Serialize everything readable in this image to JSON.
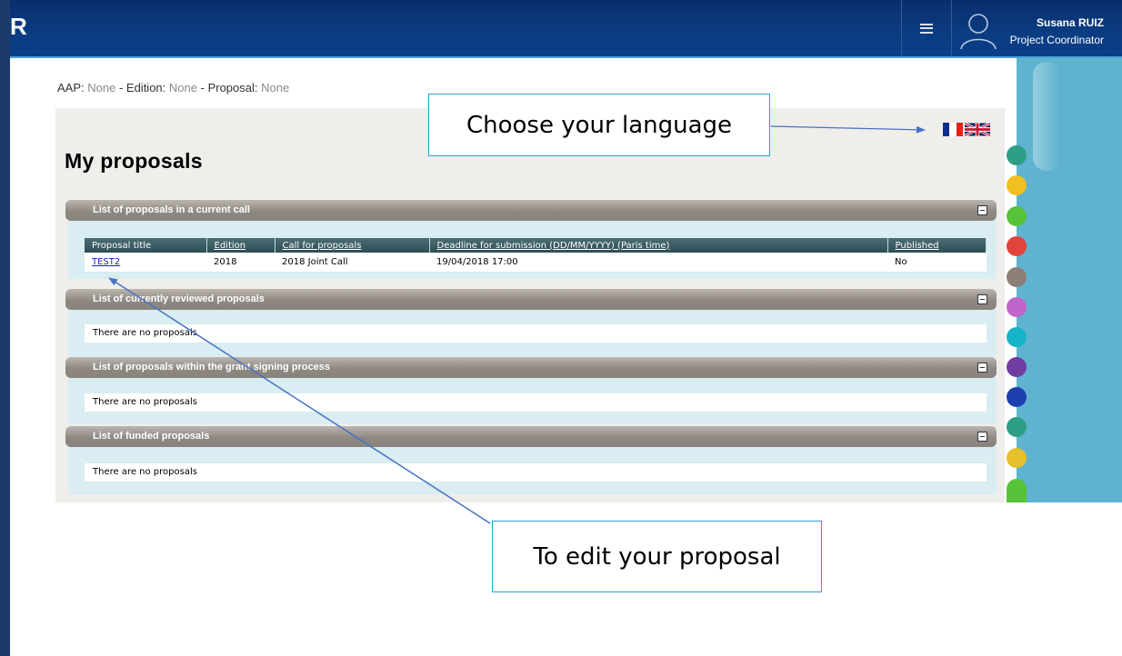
{
  "header": {
    "logo_fragment": "R",
    "user_name": "Susana RUIZ",
    "user_role": "Project Coordinator"
  },
  "breadcrumb": {
    "aap_label": "AAP:",
    "aap_value": "None",
    "edition_label": "Edition:",
    "edition_value": "None",
    "proposal_label": "Proposal:",
    "proposal_value": "None",
    "separator": " - "
  },
  "page": {
    "title": "My proposals"
  },
  "sections": [
    {
      "title": "List of proposals in a current call",
      "table": {
        "headers": [
          "Proposal title",
          "Edition",
          "Call for proposals",
          "Deadline for submission (DD/MM/YYYY) (Paris time)",
          "Published"
        ],
        "rows": [
          [
            "TEST2",
            "2018",
            "2018 Joint Call",
            "19/04/2018 17:00",
            "No"
          ]
        ]
      }
    },
    {
      "title": "List of currently reviewed proposals",
      "empty_text": "There are no proposals"
    },
    {
      "title": "List of proposals within the grant signing process",
      "empty_text": "There are no proposals"
    },
    {
      "title": "List of funded proposals",
      "empty_text": "There are no proposals"
    }
  ],
  "callouts": {
    "language": "Choose your language",
    "edit": "To edit your proposal"
  },
  "colors": {
    "topbar": "#0a3c82",
    "section_header": "#8f8882",
    "callout_border": "#2aa2d9",
    "arrow": "#4472c4"
  },
  "icons": [
    "hamburger-menu-icon",
    "user-avatar-icon",
    "flag-fr-icon",
    "flag-uk-icon",
    "collapse-icon"
  ]
}
